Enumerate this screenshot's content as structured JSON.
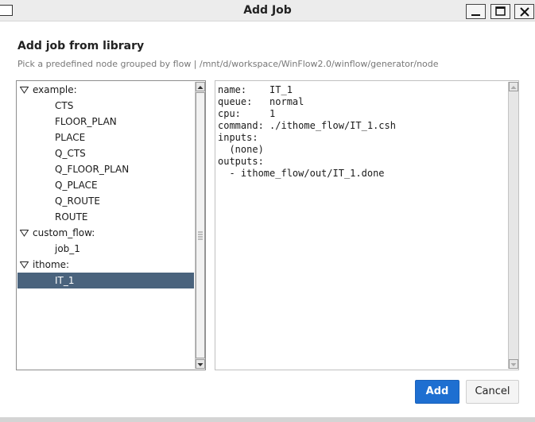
{
  "window": {
    "title": "Add Job",
    "controls": [
      "minimize",
      "maximize",
      "close"
    ]
  },
  "header": {
    "heading": "Add job from library",
    "subheading": "Pick a predefined node grouped by flow | /mnt/d/workspace/WinFlow2.0/winflow/generator/node"
  },
  "tree": {
    "groups": [
      {
        "label": "example:",
        "expanded": true,
        "items": [
          "CTS",
          "FLOOR_PLAN",
          "PLACE",
          "Q_CTS",
          "Q_FLOOR_PLAN",
          "Q_PLACE",
          "Q_ROUTE",
          "ROUTE"
        ]
      },
      {
        "label": "custom_flow:",
        "expanded": true,
        "items": [
          "job_1"
        ]
      },
      {
        "label": "ithome:",
        "expanded": true,
        "items": [
          "IT_1"
        ]
      }
    ],
    "selected": "IT_1"
  },
  "details": {
    "lines": [
      "name:    IT_1",
      "queue:   normal",
      "cpu:     1",
      "command: ./ithome_flow/IT_1.csh",
      "inputs:",
      "  (none)",
      "outputs:",
      "  - ithome_flow/out/IT_1.done"
    ]
  },
  "buttons": {
    "add_label": "Add",
    "cancel_label": "Cancel"
  },
  "colors": {
    "accent": "#1e6fd1",
    "selection": "#4a637d"
  }
}
